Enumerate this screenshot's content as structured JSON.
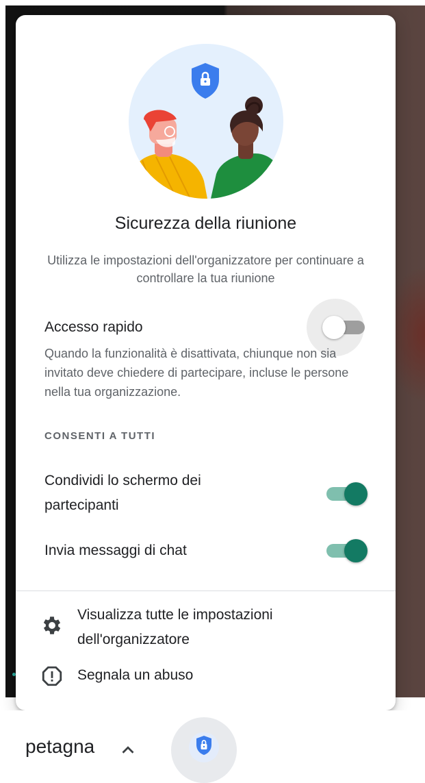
{
  "panel": {
    "title": "Sicurezza della riunione",
    "subtitle": "Utilizza le impostazioni dell'organizzatore per continuare a controllare la tua riunione",
    "quick_access": {
      "label": "Accesso rapido",
      "state": "off",
      "description": "Quando la funzionalità è disattivata, chiunque non sia invitato deve chiedere di partecipare, incluse le persone nella tua organizzazione."
    },
    "section_header": "CONSENTI A TUTTI",
    "permissions": [
      {
        "label": "Condividi lo schermo dei partecipanti",
        "state": "on"
      },
      {
        "label": "Invia messaggi di chat",
        "state": "on"
      }
    ],
    "links": [
      {
        "label": "Visualizza tutte le impostazioni dell'organizzatore",
        "icon": "gear-icon"
      },
      {
        "label": "Segnala un abuso",
        "icon": "report-icon"
      }
    ]
  },
  "bottom_bar": {
    "meeting_name": "petagna",
    "chevron_icon": "chevron-up-icon",
    "security_icon": "shield-lock-icon"
  },
  "colors": {
    "accent_green": "#137a63",
    "shield_blue": "#3b7ded",
    "text_primary": "#202124",
    "text_secondary": "#5f6368"
  }
}
